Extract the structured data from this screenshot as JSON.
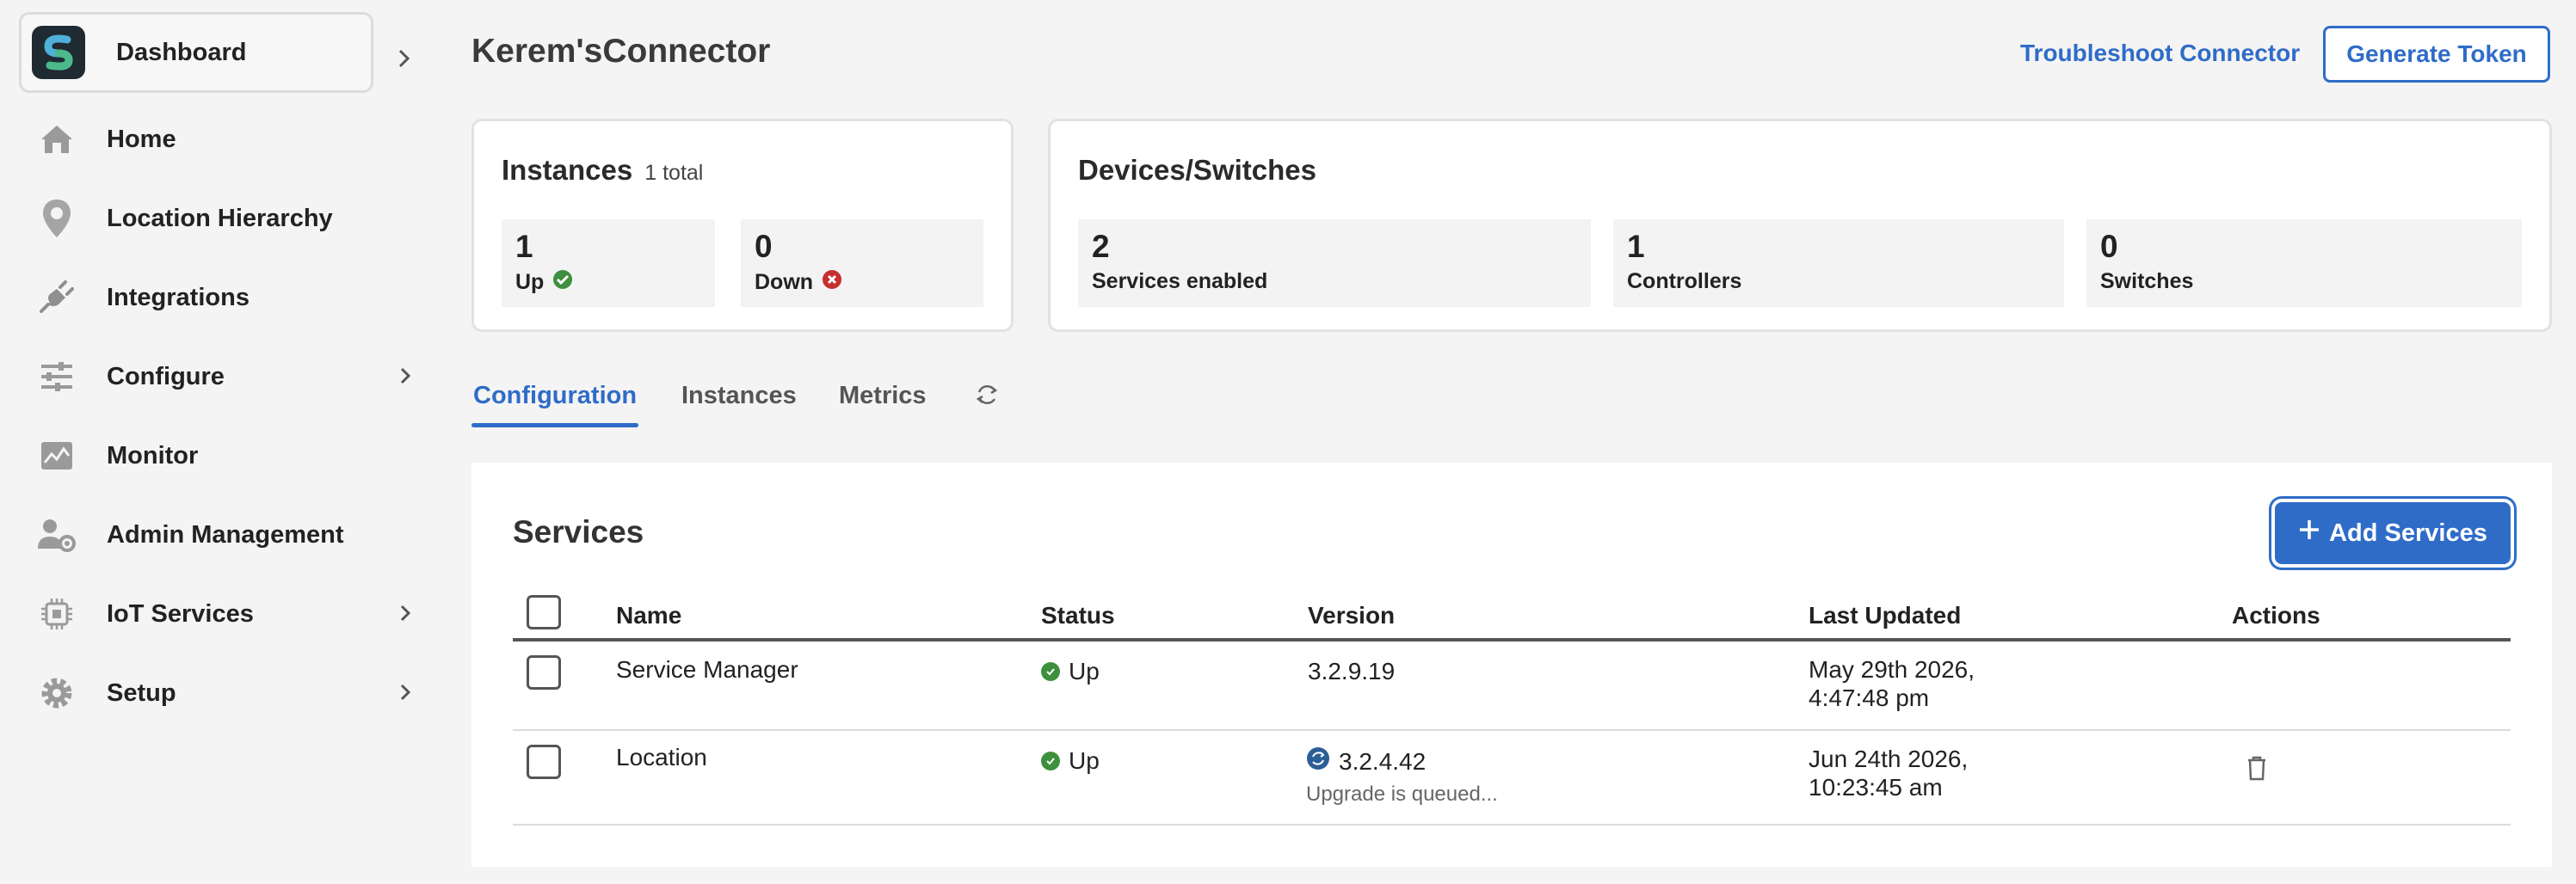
{
  "sidebar": {
    "dashboard": "Dashboard",
    "items": [
      {
        "label": "Home"
      },
      {
        "label": "Location Hierarchy"
      },
      {
        "label": "Integrations"
      },
      {
        "label": "Configure"
      },
      {
        "label": "Monitor"
      },
      {
        "label": "Admin Management"
      },
      {
        "label": "IoT Services"
      },
      {
        "label": "Setup"
      }
    ]
  },
  "header": {
    "title": "Kerem'sConnector",
    "troubleshoot": "Troubleshoot Connector",
    "generate_token": "Generate Token"
  },
  "instances_card": {
    "title": "Instances",
    "subtitle": "1 total",
    "up_count": "1",
    "up_label": "Up",
    "down_count": "0",
    "down_label": "Down"
  },
  "devices_card": {
    "title": "Devices/Switches",
    "stats": [
      {
        "value": "2",
        "label": "Services enabled"
      },
      {
        "value": "1",
        "label": "Controllers"
      },
      {
        "value": "0",
        "label": "Switches"
      }
    ]
  },
  "tabs": [
    {
      "label": "Configuration",
      "active": true
    },
    {
      "label": "Instances",
      "active": false
    },
    {
      "label": "Metrics",
      "active": false
    }
  ],
  "services": {
    "title": "Services",
    "add_button": "Add Services",
    "columns": [
      "Name",
      "Status",
      "Version",
      "Last Updated",
      "Actions"
    ],
    "rows": [
      {
        "name": "Service Manager",
        "status": "Up",
        "version": "3.2.9.19",
        "version_note": "",
        "updated_line1": "May 29th 2026,",
        "updated_line2": "4:47:48 pm"
      },
      {
        "name": "Location",
        "status": "Up",
        "version": "3.2.4.42",
        "version_note": "Upgrade is queued...",
        "updated_line1": "Jun 24th 2026,",
        "updated_line2": "10:23:45 am"
      }
    ]
  },
  "colors": {
    "accent": "#2f6cc8",
    "up": "#3e8f3e",
    "down": "#c62f2f"
  }
}
